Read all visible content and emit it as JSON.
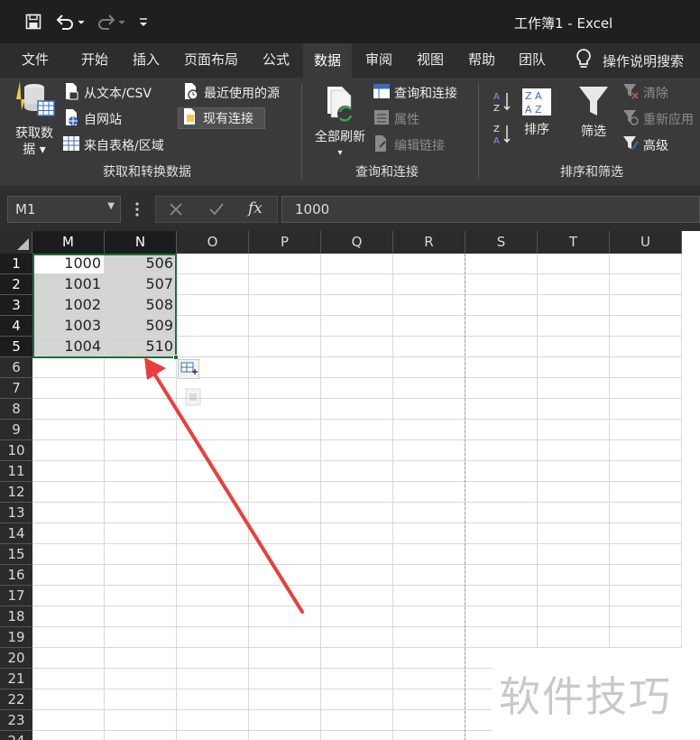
{
  "window": {
    "title": "工作簿1 - Excel"
  },
  "quick_access": {
    "save_icon": "save-icon",
    "undo_icon": "undo-icon",
    "redo_icon": "redo-icon",
    "customize_icon": "customize-qat-icon"
  },
  "tabs": [
    {
      "label": "文件"
    },
    {
      "label": "开始"
    },
    {
      "label": "插入"
    },
    {
      "label": "页面布局"
    },
    {
      "label": "公式"
    },
    {
      "label": "数据",
      "active": true
    },
    {
      "label": "审阅"
    },
    {
      "label": "视图"
    },
    {
      "label": "帮助"
    },
    {
      "label": "团队"
    }
  ],
  "tell_me": {
    "label": "操作说明搜索",
    "icon": "lightbulb-icon"
  },
  "ribbon": {
    "get_transform": {
      "group_label": "获取和转换数据",
      "get_data": {
        "line1": "获取数",
        "line2": "据"
      },
      "from_text": "从文本/CSV",
      "from_web": "自网站",
      "from_table": "来自表格/区域",
      "recent_sources": "最近使用的源",
      "existing_connections": "现有连接"
    },
    "queries": {
      "group_label": "查询和连接",
      "refresh_all": "全部刷新",
      "queries_connections": "查询和连接",
      "properties": "属性",
      "edit_links": "编辑链接"
    },
    "sort_filter": {
      "group_label": "排序和筛选",
      "sort": "排序",
      "filter": "筛选",
      "clear": "清除",
      "reapply": "重新应用",
      "advanced": "高级"
    }
  },
  "formula_bar": {
    "name_box": "M1",
    "formula": "1000",
    "cancel_icon": "cancel-icon",
    "enter_icon": "enter-icon",
    "fx_label": "fx"
  },
  "sheet": {
    "columns": [
      "M",
      "N",
      "O",
      "P",
      "Q",
      "R",
      "S",
      "T",
      "U"
    ],
    "selected_columns": [
      "M",
      "N"
    ],
    "rows": [
      1,
      2,
      3,
      4,
      5,
      6,
      7,
      8,
      9,
      10,
      11,
      12,
      13,
      14,
      15,
      16,
      17,
      18,
      19,
      20,
      21,
      22,
      23,
      24
    ],
    "selected_rows": [
      1,
      2,
      3,
      4,
      5
    ],
    "data": [
      [
        "1000",
        "506"
      ],
      [
        "1001",
        "507"
      ],
      [
        "1002",
        "508"
      ],
      [
        "1003",
        "509"
      ],
      [
        "1004",
        "510"
      ]
    ]
  },
  "watermark": "软件技巧"
}
